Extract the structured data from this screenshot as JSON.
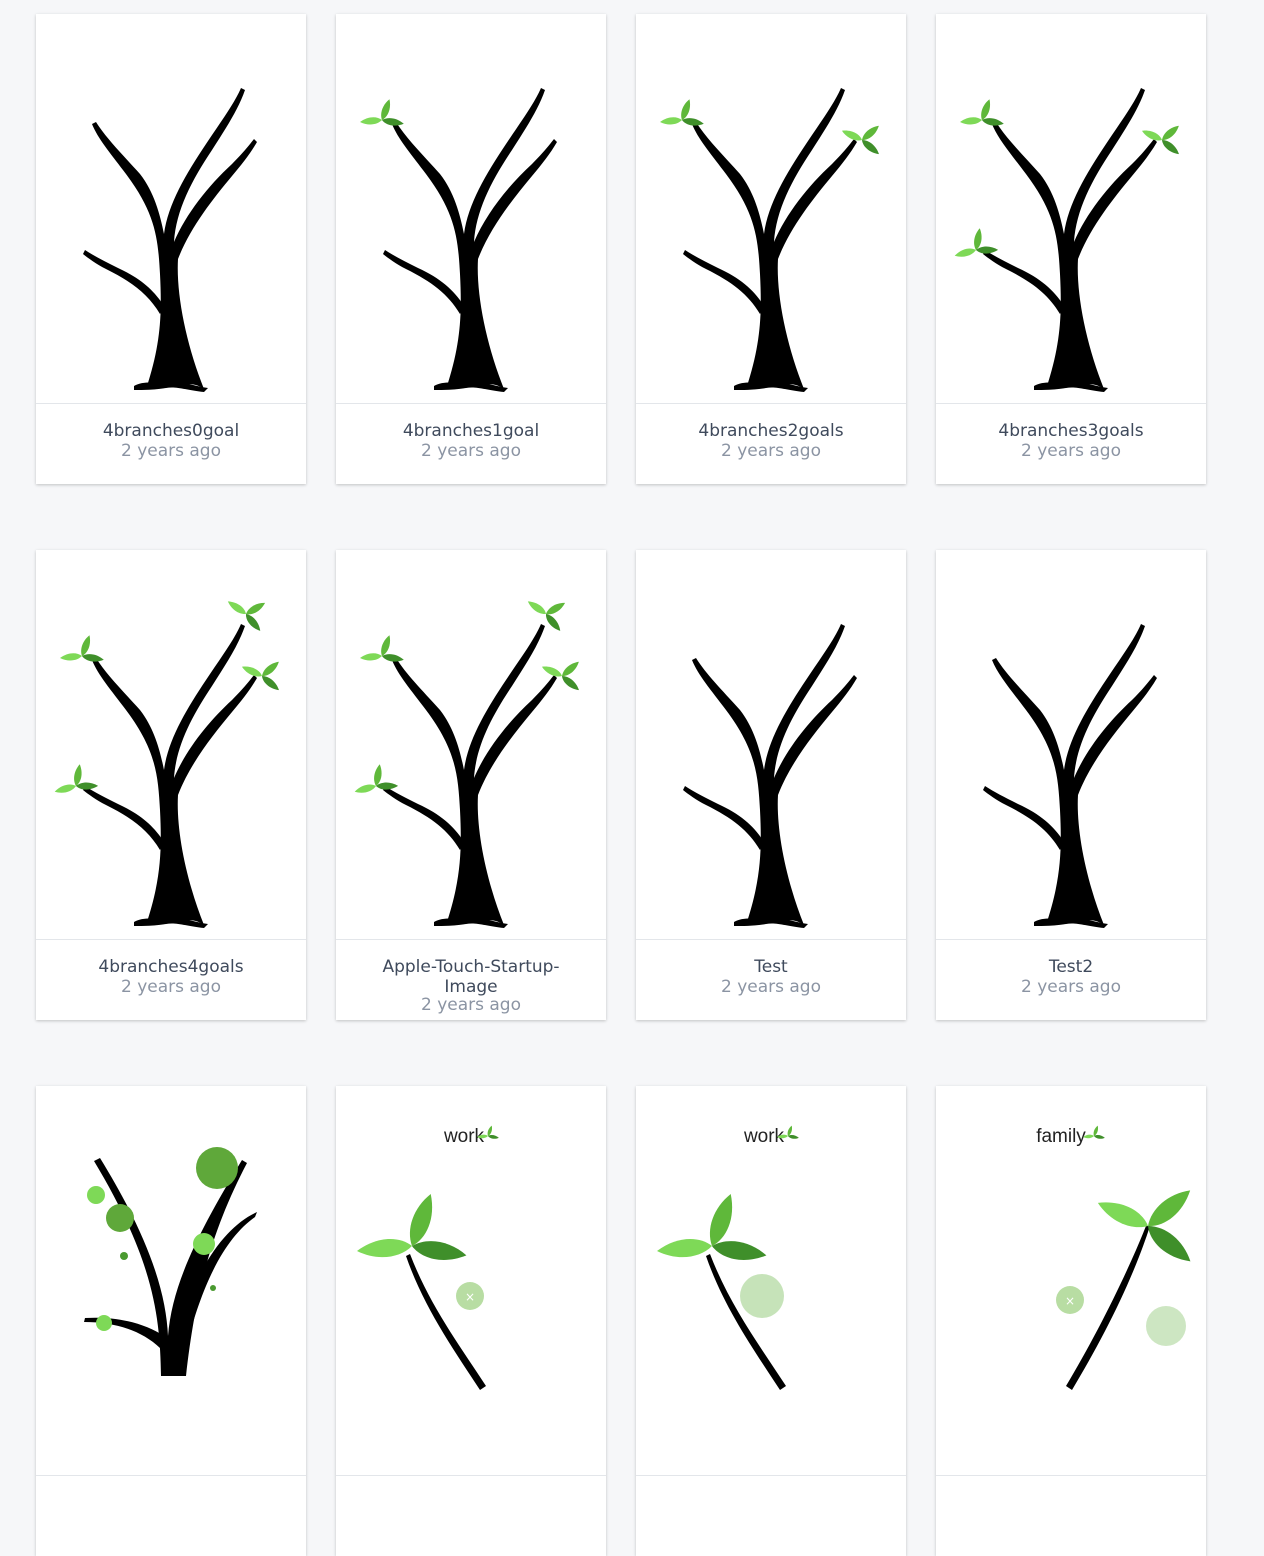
{
  "cards": [
    {
      "name": "4branches0goal",
      "age": "2 years ago",
      "thumbnail": "tree-0-goals"
    },
    {
      "name": "4branches1goal",
      "age": "2 years ago",
      "thumbnail": "tree-1-goal"
    },
    {
      "name": "4branches2goals",
      "age": "2 years ago",
      "thumbnail": "tree-2-goals"
    },
    {
      "name": "4branches3goals",
      "age": "2 years ago",
      "thumbnail": "tree-3-goals"
    },
    {
      "name": "4branches4goals",
      "age": "2 years ago",
      "thumbnail": "tree-4-goals"
    },
    {
      "name": "Apple-Touch-Startup-Image",
      "age": "2 years ago",
      "thumbnail": "tree-4-goals"
    },
    {
      "name": "Test",
      "age": "2 years ago",
      "thumbnail": "tree-bare"
    },
    {
      "name": "Test2",
      "age": "2 years ago",
      "thumbnail": "tree-bare"
    },
    {
      "name": "",
      "age": "",
      "thumbnail": "tree-dots"
    },
    {
      "name": "",
      "age": "",
      "thumbnail": "leaf-label",
      "label": "work"
    },
    {
      "name": "",
      "age": "",
      "thumbnail": "leaf-label",
      "label": "work"
    },
    {
      "name": "",
      "age": "",
      "thumbnail": "leaf-label",
      "label": "family"
    }
  ],
  "colors": {
    "leaf_light": "#7ed957",
    "leaf_mid": "#5fb83a",
    "leaf_dark": "#3f8f2a",
    "trunk": "#000000"
  }
}
